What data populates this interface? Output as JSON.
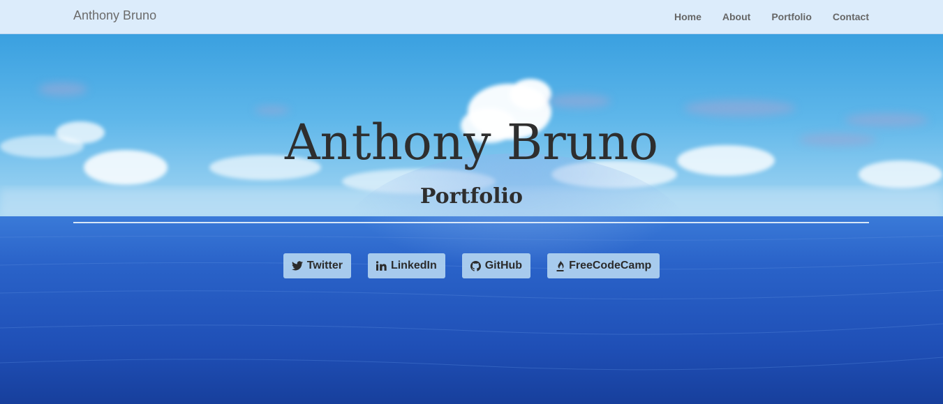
{
  "navbar": {
    "brand": "Anthony Bruno",
    "links": [
      {
        "label": "Home"
      },
      {
        "label": "About"
      },
      {
        "label": "Portfolio"
      },
      {
        "label": "Contact"
      }
    ]
  },
  "hero": {
    "title": "Anthony Bruno",
    "subtitle": "Portfolio",
    "social": [
      {
        "label": "Twitter",
        "icon": "twitter-icon"
      },
      {
        "label": "LinkedIn",
        "icon": "linkedin-icon"
      },
      {
        "label": "GitHub",
        "icon": "github-icon"
      },
      {
        "label": "FreeCodeCamp",
        "icon": "fire-icon"
      }
    ]
  },
  "colors": {
    "navbar_bg": "#dcecfb",
    "sky_top": "#2f9fe0",
    "ocean_deep": "#1a47b0",
    "button_bg": "#b2d4f0",
    "text_dark": "#2e2e2e"
  }
}
